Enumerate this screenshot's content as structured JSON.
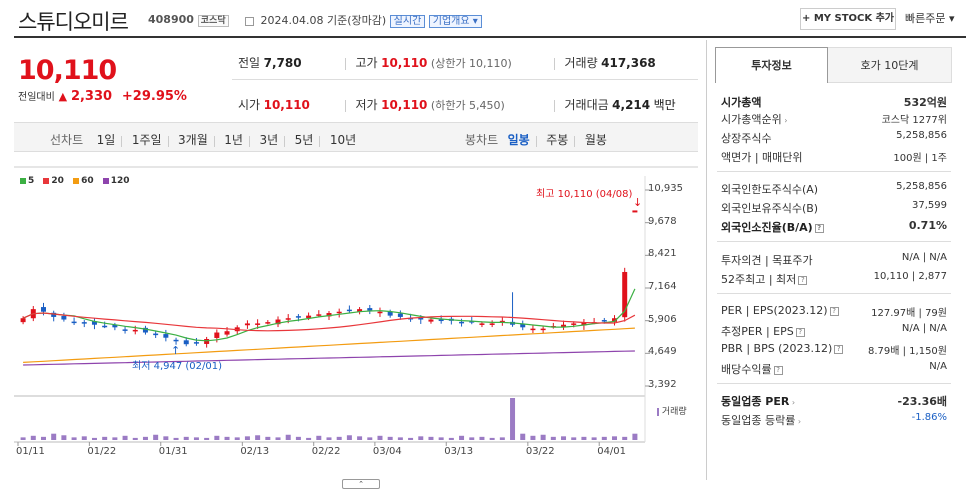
{
  "header": {
    "name": "스튜디오미르",
    "code": "408900",
    "market": "코스닥",
    "date": "2024.04.08 기준(장마감)",
    "realtime_label": "실시간",
    "company_info_label": "기업개요 ▾",
    "mystock_label": "+ MY STOCK 추가",
    "quick_order_label": "빠른주문 ▾"
  },
  "price": {
    "current": "10,110",
    "change_label": "전일대비",
    "change": "2,330",
    "change_pct": "+29.95%"
  },
  "summary": {
    "prev_label": "전일",
    "prev": "7,780",
    "high_label": "고가",
    "high": "10,110",
    "high_sub": "(상한가 10,110)",
    "volume_label": "거래량",
    "volume": "417,368",
    "open_label": "시가",
    "open": "10,110",
    "low_label": "저가",
    "low": "10,110",
    "low_sub": "(하한가 5,450)",
    "amount_label": "거래대금",
    "amount": "4,214",
    "amount_unit": "백만"
  },
  "period_tabs": {
    "line_label": "선차트",
    "items": [
      "1일",
      "1주일",
      "3개월",
      "1년",
      "3년",
      "5년",
      "10년"
    ],
    "candle_label": "봉차트",
    "candle_items": [
      "일봉",
      "주봉",
      "월봉"
    ],
    "active_candle": "일봉"
  },
  "chart_data": {
    "type": "candlestick",
    "legend": [
      {
        "name": "5",
        "color": "#3cb043"
      },
      {
        "name": "20",
        "color": "#e8373b"
      },
      {
        "name": "60",
        "color": "#f39c12"
      },
      {
        "name": "120",
        "color": "#8e44ad"
      }
    ],
    "yticks": [
      "10,935",
      "9,678",
      "8,421",
      "7,164",
      "5,906",
      "4,649",
      "3,392"
    ],
    "ylim": [
      3392,
      10935
    ],
    "xticks": [
      "01/11",
      "01/22",
      "01/31",
      "02/13",
      "02/22",
      "03/04",
      "03/13",
      "03/22",
      "04/01"
    ],
    "high_annotation": "최고 10,110 (04/08)",
    "low_annotation": "최저 4,947 (02/01)",
    "volume_label": "거래량",
    "closes": [
      6000,
      6350,
      6250,
      6050,
      5950,
      5850,
      5800,
      5750,
      5700,
      5650,
      5550,
      5550,
      5450,
      5350,
      5250,
      5150,
      5000,
      5050,
      5200,
      5450,
      5500,
      5650,
      5800,
      5800,
      5850,
      5950,
      6000,
      6050,
      6100,
      6150,
      6200,
      6250,
      6300,
      6350,
      6300,
      6250,
      6100,
      6050,
      6000,
      5950,
      5950,
      5900,
      5900,
      5850,
      5850,
      5800,
      5800,
      5900,
      5750,
      5650,
      5600,
      5600,
      5700,
      5750,
      5800,
      5850,
      5850,
      5900,
      6000,
      7780,
      10110
    ],
    "volumes": [
      5,
      8,
      6,
      12,
      9,
      5,
      7,
      4,
      6,
      5,
      8,
      4,
      6,
      10,
      7,
      4,
      6,
      5,
      4,
      8,
      6,
      5,
      7,
      9,
      6,
      5,
      10,
      6,
      4,
      8,
      5,
      6,
      9,
      7,
      5,
      8,
      6,
      5,
      4,
      7,
      6,
      5,
      4,
      8,
      5,
      6,
      4,
      5,
      80,
      12,
      8,
      10,
      6,
      7,
      5,
      6,
      5,
      6,
      7,
      6,
      12
    ]
  },
  "invest_tabs": {
    "tab1": "투자정보",
    "tab2": "호가 10단계"
  },
  "invest": {
    "mcap_label": "시가총액",
    "mcap": "532억원",
    "mcap_rank_label": "시가총액순위",
    "mcap_rank": "코스닥 1277위",
    "shares_label": "상장주식수",
    "shares": "5,258,856",
    "par_label": "액면가 | 매매단위",
    "par": "100원 | 1주",
    "foreign_limit_label": "외국인한도주식수(A)",
    "foreign_limit": "5,258,856",
    "foreign_hold_label": "외국인보유주식수(B)",
    "foreign_hold": "37,599",
    "foreign_ratio_label": "외국인소진율(B/A)",
    "foreign_ratio": "0.71%",
    "opinion_label": "투자의견 | 목표주가",
    "opinion": "N/A | N/A",
    "w52_label": "52주최고 | 최저",
    "w52": "10,110 | 2,877",
    "per_label": "PER | EPS(2023.12)",
    "per": "127.97배 | 79원",
    "est_per_label": "추정PER | EPS",
    "est_per": "N/A | N/A",
    "pbr_label": "PBR | BPS (2023.12)",
    "pbr": "8.79배 | 1,150원",
    "div_label": "배당수익률",
    "div": "N/A",
    "sector_per_label": "동일업종 PER",
    "sector_per": "-23.36배",
    "sector_rate_label": "동일업종 등락률",
    "sector_rate": "-1.86%"
  }
}
